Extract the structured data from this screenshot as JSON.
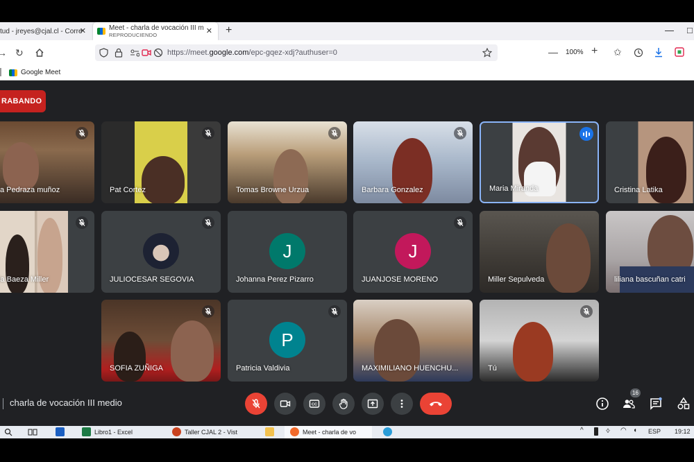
{
  "browser": {
    "tabs": [
      {
        "label": "tud - jreyes@cjal.cl - Corre",
        "active": false
      },
      {
        "label": "Meet - charla de vocación III m",
        "sublabel": "REPRODUCIENDO",
        "active": true
      }
    ],
    "url_prefix": "https://meet.",
    "url_host": "google.com",
    "url_path": "/epc-gqez-xdj?authuser=0",
    "zoom": "100%",
    "bookmark": "Google Meet"
  },
  "meet": {
    "recording_label": "RABANDO",
    "meeting_name": "charla de vocación III medio",
    "participants_count": "16",
    "colors": {
      "background": "#202124",
      "tile": "#3c4043",
      "danger": "#ea4335",
      "speaking": "#8ab4f8",
      "johanna": "#00796b",
      "juanjose": "#c2185b",
      "patricia": "#00838f"
    },
    "tiles": [
      {
        "name": "a Pedraza muñoz",
        "muted": true
      },
      {
        "name": "Pat Cortez",
        "muted": true
      },
      {
        "name": "Tomas Browne Urzua",
        "muted": true
      },
      {
        "name": "Barbara Gonzalez",
        "muted": true
      },
      {
        "name": "Maria Miranda",
        "speaking": true
      },
      {
        "name": "Cristina Latika",
        "muted": false
      },
      {
        "name": "ia Baeza Miller",
        "muted": true
      },
      {
        "name": "JULIOCESAR SEGOVIA",
        "muted": true
      },
      {
        "name": "Johanna Perez Pizarro",
        "initial": "J",
        "muted": false
      },
      {
        "name": "JUANJOSE MORENO",
        "initial": "J",
        "muted": true
      },
      {
        "name": "Miller Sepulveda",
        "muted": false
      },
      {
        "name": "liliana bascuñan catri",
        "muted": false
      },
      {
        "name": "SOFIA ZUÑIGA",
        "muted": true
      },
      {
        "name": "Patricia Valdivia",
        "initial": "P",
        "muted": true
      },
      {
        "name": "MAXIMILIANO HUENCHU...",
        "muted": false
      },
      {
        "name": "Tú",
        "muted": true
      }
    ]
  },
  "taskbar": {
    "items": [
      "Libro1 - Excel",
      "Taller CJAL 2 - Vist",
      "Meet - charla de vo"
    ],
    "lang": "ESP",
    "time": "19:12"
  }
}
